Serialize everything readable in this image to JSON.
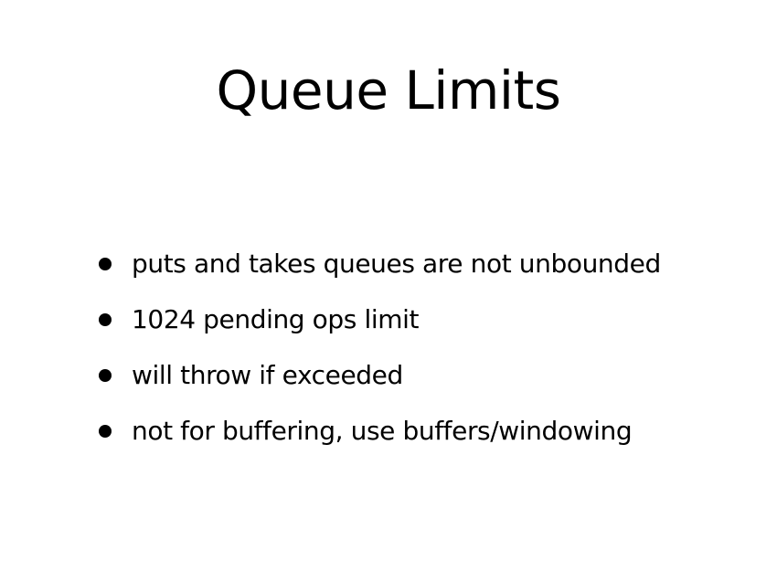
{
  "slide": {
    "title": "Queue Limits",
    "bullets": [
      "puts and takes queues are not unbounded",
      "1024 pending ops limit",
      "will throw if exceeded",
      "not for buffering, use buffers/windowing"
    ]
  }
}
